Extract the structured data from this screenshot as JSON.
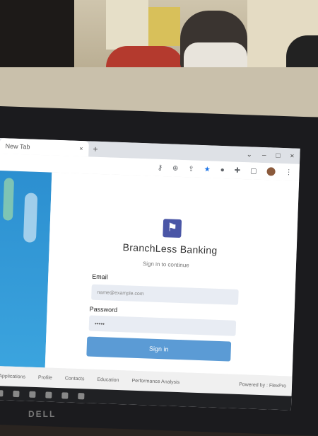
{
  "browser": {
    "tab_title": "New Tab",
    "tab_close": "×",
    "new_tab": "+",
    "window_controls": [
      "⌄",
      "–",
      "□",
      "×"
    ]
  },
  "login": {
    "app_title": "BranchLess Banking",
    "subtitle": "Sign in to continue",
    "email_label": "Email",
    "email_value": "name@example.com",
    "password_label": "Password",
    "password_value": "•••••",
    "signin_label": "Sign in"
  },
  "footer": {
    "items": [
      "Applications",
      "Profile",
      "Contacts",
      "Education",
      "Performance Analysis"
    ],
    "powered": "Powered by : FlexPro"
  },
  "bezel": {
    "brand": "DELL"
  },
  "colors": {
    "accent": "#5b9bd5",
    "logo": "#4a56a6",
    "sidebar": "#2c8fd0"
  }
}
